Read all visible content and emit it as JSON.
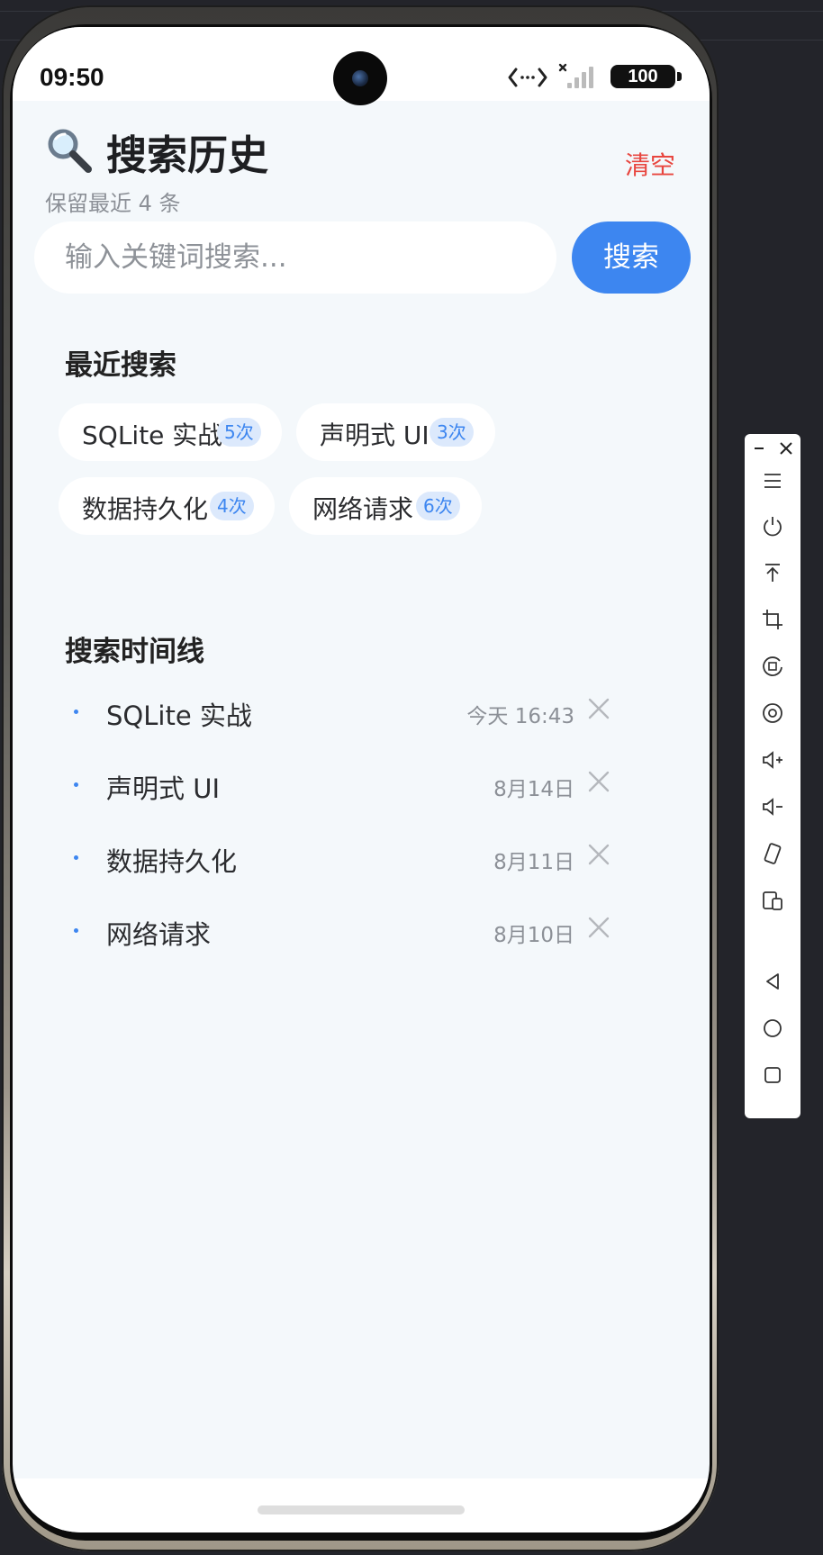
{
  "status_bar": {
    "time": "09:50",
    "battery": "100",
    "icons": [
      "data-transfer-icon",
      "signal-icon",
      "battery-icon"
    ]
  },
  "header": {
    "icon": "magnifier-icon",
    "title": "搜索历史",
    "subtitle": "保留最近 4 条",
    "clear_label": "清空"
  },
  "search": {
    "placeholder": "输入关键词搜索...",
    "value": "",
    "button_label": "搜索"
  },
  "recent": {
    "title": "最近搜索",
    "chips": [
      {
        "label": "SQLite 实战",
        "count": "5次"
      },
      {
        "label": "声明式 UI",
        "count": "3次"
      },
      {
        "label": "数据持久化",
        "count": "4次"
      },
      {
        "label": "网络请求",
        "count": "6次"
      }
    ]
  },
  "timeline": {
    "title": "搜索时间线",
    "items": [
      {
        "label": "SQLite 实战",
        "time": "今天 16:43"
      },
      {
        "label": "声明式 UI",
        "time": "8月14日"
      },
      {
        "label": "数据持久化",
        "time": "8月11日"
      },
      {
        "label": "网络请求",
        "time": "8月10日"
      }
    ]
  },
  "colors": {
    "accent": "#3d86f0",
    "danger": "#e8463f",
    "background": "#f4f8fb",
    "badge_bg": "#dce9fc"
  },
  "side_toolbar": {
    "items": [
      "minimize-icon",
      "close-icon",
      "menu-icon",
      "power-icon",
      "pin-top-icon",
      "crop-icon",
      "rotate-icon",
      "screenshot-icon",
      "volume-up-icon",
      "volume-down-icon",
      "shake-icon",
      "multi-device-icon",
      "back-icon",
      "home-icon",
      "recents-icon"
    ]
  }
}
